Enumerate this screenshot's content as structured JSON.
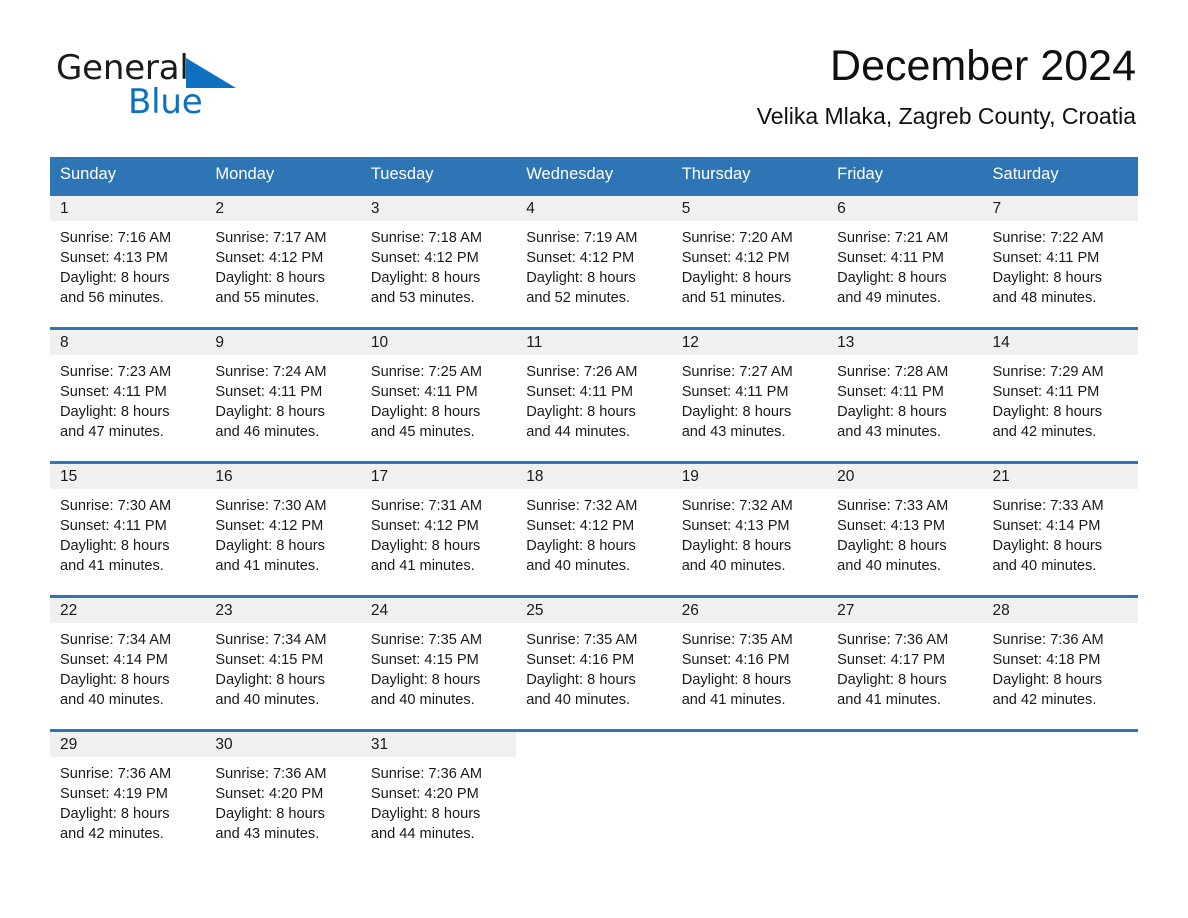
{
  "brand": {
    "name_part1": "General",
    "name_part2": "Blue",
    "triangle_color": "#0f6fc0"
  },
  "header": {
    "title": "December 2024",
    "subtitle": "Velika Mlaka, Zagreb County, Croatia"
  },
  "theme": {
    "accent": "#2e75b6",
    "daynum_band": "#f0f0f0",
    "header_text": "#ffffff",
    "body_text": "#1a1a1a"
  },
  "weekdays": [
    "Sunday",
    "Monday",
    "Tuesday",
    "Wednesday",
    "Thursday",
    "Friday",
    "Saturday"
  ],
  "weeks": [
    [
      {
        "day": "1",
        "sunrise": "Sunrise: 7:16 AM",
        "sunset": "Sunset: 4:13 PM",
        "daylight1": "Daylight: 8 hours",
        "daylight2": "and 56 minutes."
      },
      {
        "day": "2",
        "sunrise": "Sunrise: 7:17 AM",
        "sunset": "Sunset: 4:12 PM",
        "daylight1": "Daylight: 8 hours",
        "daylight2": "and 55 minutes."
      },
      {
        "day": "3",
        "sunrise": "Sunrise: 7:18 AM",
        "sunset": "Sunset: 4:12 PM",
        "daylight1": "Daylight: 8 hours",
        "daylight2": "and 53 minutes."
      },
      {
        "day": "4",
        "sunrise": "Sunrise: 7:19 AM",
        "sunset": "Sunset: 4:12 PM",
        "daylight1": "Daylight: 8 hours",
        "daylight2": "and 52 minutes."
      },
      {
        "day": "5",
        "sunrise": "Sunrise: 7:20 AM",
        "sunset": "Sunset: 4:12 PM",
        "daylight1": "Daylight: 8 hours",
        "daylight2": "and 51 minutes."
      },
      {
        "day": "6",
        "sunrise": "Sunrise: 7:21 AM",
        "sunset": "Sunset: 4:11 PM",
        "daylight1": "Daylight: 8 hours",
        "daylight2": "and 49 minutes."
      },
      {
        "day": "7",
        "sunrise": "Sunrise: 7:22 AM",
        "sunset": "Sunset: 4:11 PM",
        "daylight1": "Daylight: 8 hours",
        "daylight2": "and 48 minutes."
      }
    ],
    [
      {
        "day": "8",
        "sunrise": "Sunrise: 7:23 AM",
        "sunset": "Sunset: 4:11 PM",
        "daylight1": "Daylight: 8 hours",
        "daylight2": "and 47 minutes."
      },
      {
        "day": "9",
        "sunrise": "Sunrise: 7:24 AM",
        "sunset": "Sunset: 4:11 PM",
        "daylight1": "Daylight: 8 hours",
        "daylight2": "and 46 minutes."
      },
      {
        "day": "10",
        "sunrise": "Sunrise: 7:25 AM",
        "sunset": "Sunset: 4:11 PM",
        "daylight1": "Daylight: 8 hours",
        "daylight2": "and 45 minutes."
      },
      {
        "day": "11",
        "sunrise": "Sunrise: 7:26 AM",
        "sunset": "Sunset: 4:11 PM",
        "daylight1": "Daylight: 8 hours",
        "daylight2": "and 44 minutes."
      },
      {
        "day": "12",
        "sunrise": "Sunrise: 7:27 AM",
        "sunset": "Sunset: 4:11 PM",
        "daylight1": "Daylight: 8 hours",
        "daylight2": "and 43 minutes."
      },
      {
        "day": "13",
        "sunrise": "Sunrise: 7:28 AM",
        "sunset": "Sunset: 4:11 PM",
        "daylight1": "Daylight: 8 hours",
        "daylight2": "and 43 minutes."
      },
      {
        "day": "14",
        "sunrise": "Sunrise: 7:29 AM",
        "sunset": "Sunset: 4:11 PM",
        "daylight1": "Daylight: 8 hours",
        "daylight2": "and 42 minutes."
      }
    ],
    [
      {
        "day": "15",
        "sunrise": "Sunrise: 7:30 AM",
        "sunset": "Sunset: 4:11 PM",
        "daylight1": "Daylight: 8 hours",
        "daylight2": "and 41 minutes."
      },
      {
        "day": "16",
        "sunrise": "Sunrise: 7:30 AM",
        "sunset": "Sunset: 4:12 PM",
        "daylight1": "Daylight: 8 hours",
        "daylight2": "and 41 minutes."
      },
      {
        "day": "17",
        "sunrise": "Sunrise: 7:31 AM",
        "sunset": "Sunset: 4:12 PM",
        "daylight1": "Daylight: 8 hours",
        "daylight2": "and 41 minutes."
      },
      {
        "day": "18",
        "sunrise": "Sunrise: 7:32 AM",
        "sunset": "Sunset: 4:12 PM",
        "daylight1": "Daylight: 8 hours",
        "daylight2": "and 40 minutes."
      },
      {
        "day": "19",
        "sunrise": "Sunrise: 7:32 AM",
        "sunset": "Sunset: 4:13 PM",
        "daylight1": "Daylight: 8 hours",
        "daylight2": "and 40 minutes."
      },
      {
        "day": "20",
        "sunrise": "Sunrise: 7:33 AM",
        "sunset": "Sunset: 4:13 PM",
        "daylight1": "Daylight: 8 hours",
        "daylight2": "and 40 minutes."
      },
      {
        "day": "21",
        "sunrise": "Sunrise: 7:33 AM",
        "sunset": "Sunset: 4:14 PM",
        "daylight1": "Daylight: 8 hours",
        "daylight2": "and 40 minutes."
      }
    ],
    [
      {
        "day": "22",
        "sunrise": "Sunrise: 7:34 AM",
        "sunset": "Sunset: 4:14 PM",
        "daylight1": "Daylight: 8 hours",
        "daylight2": "and 40 minutes."
      },
      {
        "day": "23",
        "sunrise": "Sunrise: 7:34 AM",
        "sunset": "Sunset: 4:15 PM",
        "daylight1": "Daylight: 8 hours",
        "daylight2": "and 40 minutes."
      },
      {
        "day": "24",
        "sunrise": "Sunrise: 7:35 AM",
        "sunset": "Sunset: 4:15 PM",
        "daylight1": "Daylight: 8 hours",
        "daylight2": "and 40 minutes."
      },
      {
        "day": "25",
        "sunrise": "Sunrise: 7:35 AM",
        "sunset": "Sunset: 4:16 PM",
        "daylight1": "Daylight: 8 hours",
        "daylight2": "and 40 minutes."
      },
      {
        "day": "26",
        "sunrise": "Sunrise: 7:35 AM",
        "sunset": "Sunset: 4:16 PM",
        "daylight1": "Daylight: 8 hours",
        "daylight2": "and 41 minutes."
      },
      {
        "day": "27",
        "sunrise": "Sunrise: 7:36 AM",
        "sunset": "Sunset: 4:17 PM",
        "daylight1": "Daylight: 8 hours",
        "daylight2": "and 41 minutes."
      },
      {
        "day": "28",
        "sunrise": "Sunrise: 7:36 AM",
        "sunset": "Sunset: 4:18 PM",
        "daylight1": "Daylight: 8 hours",
        "daylight2": "and 42 minutes."
      }
    ],
    [
      {
        "day": "29",
        "sunrise": "Sunrise: 7:36 AM",
        "sunset": "Sunset: 4:19 PM",
        "daylight1": "Daylight: 8 hours",
        "daylight2": "and 42 minutes."
      },
      {
        "day": "30",
        "sunrise": "Sunrise: 7:36 AM",
        "sunset": "Sunset: 4:20 PM",
        "daylight1": "Daylight: 8 hours",
        "daylight2": "and 43 minutes."
      },
      {
        "day": "31",
        "sunrise": "Sunrise: 7:36 AM",
        "sunset": "Sunset: 4:20 PM",
        "daylight1": "Daylight: 8 hours",
        "daylight2": "and 44 minutes."
      },
      {
        "day": "",
        "sunrise": "",
        "sunset": "",
        "daylight1": "",
        "daylight2": ""
      },
      {
        "day": "",
        "sunrise": "",
        "sunset": "",
        "daylight1": "",
        "daylight2": ""
      },
      {
        "day": "",
        "sunrise": "",
        "sunset": "",
        "daylight1": "",
        "daylight2": ""
      },
      {
        "day": "",
        "sunrise": "",
        "sunset": "",
        "daylight1": "",
        "daylight2": ""
      }
    ]
  ]
}
